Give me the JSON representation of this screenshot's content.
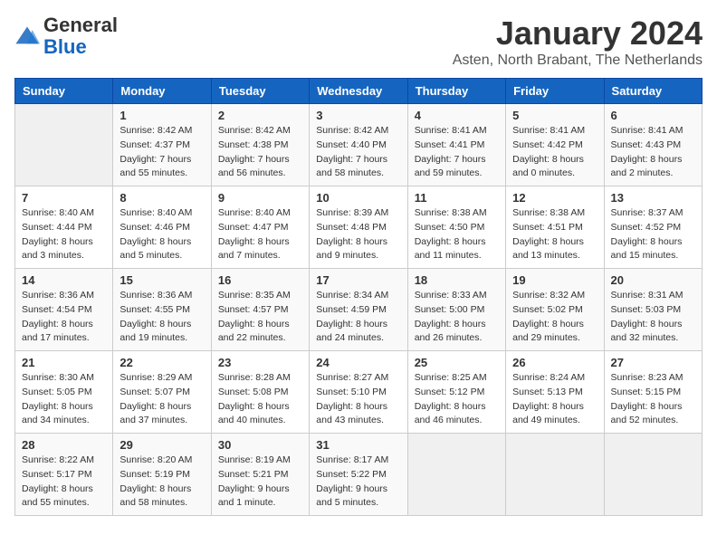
{
  "header": {
    "logo_line1": "General",
    "logo_line2": "Blue",
    "month": "January 2024",
    "location": "Asten, North Brabant, The Netherlands"
  },
  "weekdays": [
    "Sunday",
    "Monday",
    "Tuesday",
    "Wednesday",
    "Thursday",
    "Friday",
    "Saturday"
  ],
  "weeks": [
    [
      {
        "day": "",
        "sunrise": "",
        "sunset": "",
        "daylight": ""
      },
      {
        "day": "1",
        "sunrise": "Sunrise: 8:42 AM",
        "sunset": "Sunset: 4:37 PM",
        "daylight": "Daylight: 7 hours and 55 minutes."
      },
      {
        "day": "2",
        "sunrise": "Sunrise: 8:42 AM",
        "sunset": "Sunset: 4:38 PM",
        "daylight": "Daylight: 7 hours and 56 minutes."
      },
      {
        "day": "3",
        "sunrise": "Sunrise: 8:42 AM",
        "sunset": "Sunset: 4:40 PM",
        "daylight": "Daylight: 7 hours and 58 minutes."
      },
      {
        "day": "4",
        "sunrise": "Sunrise: 8:41 AM",
        "sunset": "Sunset: 4:41 PM",
        "daylight": "Daylight: 7 hours and 59 minutes."
      },
      {
        "day": "5",
        "sunrise": "Sunrise: 8:41 AM",
        "sunset": "Sunset: 4:42 PM",
        "daylight": "Daylight: 8 hours and 0 minutes."
      },
      {
        "day": "6",
        "sunrise": "Sunrise: 8:41 AM",
        "sunset": "Sunset: 4:43 PM",
        "daylight": "Daylight: 8 hours and 2 minutes."
      }
    ],
    [
      {
        "day": "7",
        "sunrise": "Sunrise: 8:40 AM",
        "sunset": "Sunset: 4:44 PM",
        "daylight": "Daylight: 8 hours and 3 minutes."
      },
      {
        "day": "8",
        "sunrise": "Sunrise: 8:40 AM",
        "sunset": "Sunset: 4:46 PM",
        "daylight": "Daylight: 8 hours and 5 minutes."
      },
      {
        "day": "9",
        "sunrise": "Sunrise: 8:40 AM",
        "sunset": "Sunset: 4:47 PM",
        "daylight": "Daylight: 8 hours and 7 minutes."
      },
      {
        "day": "10",
        "sunrise": "Sunrise: 8:39 AM",
        "sunset": "Sunset: 4:48 PM",
        "daylight": "Daylight: 8 hours and 9 minutes."
      },
      {
        "day": "11",
        "sunrise": "Sunrise: 8:38 AM",
        "sunset": "Sunset: 4:50 PM",
        "daylight": "Daylight: 8 hours and 11 minutes."
      },
      {
        "day": "12",
        "sunrise": "Sunrise: 8:38 AM",
        "sunset": "Sunset: 4:51 PM",
        "daylight": "Daylight: 8 hours and 13 minutes."
      },
      {
        "day": "13",
        "sunrise": "Sunrise: 8:37 AM",
        "sunset": "Sunset: 4:52 PM",
        "daylight": "Daylight: 8 hours and 15 minutes."
      }
    ],
    [
      {
        "day": "14",
        "sunrise": "Sunrise: 8:36 AM",
        "sunset": "Sunset: 4:54 PM",
        "daylight": "Daylight: 8 hours and 17 minutes."
      },
      {
        "day": "15",
        "sunrise": "Sunrise: 8:36 AM",
        "sunset": "Sunset: 4:55 PM",
        "daylight": "Daylight: 8 hours and 19 minutes."
      },
      {
        "day": "16",
        "sunrise": "Sunrise: 8:35 AM",
        "sunset": "Sunset: 4:57 PM",
        "daylight": "Daylight: 8 hours and 22 minutes."
      },
      {
        "day": "17",
        "sunrise": "Sunrise: 8:34 AM",
        "sunset": "Sunset: 4:59 PM",
        "daylight": "Daylight: 8 hours and 24 minutes."
      },
      {
        "day": "18",
        "sunrise": "Sunrise: 8:33 AM",
        "sunset": "Sunset: 5:00 PM",
        "daylight": "Daylight: 8 hours and 26 minutes."
      },
      {
        "day": "19",
        "sunrise": "Sunrise: 8:32 AM",
        "sunset": "Sunset: 5:02 PM",
        "daylight": "Daylight: 8 hours and 29 minutes."
      },
      {
        "day": "20",
        "sunrise": "Sunrise: 8:31 AM",
        "sunset": "Sunset: 5:03 PM",
        "daylight": "Daylight: 8 hours and 32 minutes."
      }
    ],
    [
      {
        "day": "21",
        "sunrise": "Sunrise: 8:30 AM",
        "sunset": "Sunset: 5:05 PM",
        "daylight": "Daylight: 8 hours and 34 minutes."
      },
      {
        "day": "22",
        "sunrise": "Sunrise: 8:29 AM",
        "sunset": "Sunset: 5:07 PM",
        "daylight": "Daylight: 8 hours and 37 minutes."
      },
      {
        "day": "23",
        "sunrise": "Sunrise: 8:28 AM",
        "sunset": "Sunset: 5:08 PM",
        "daylight": "Daylight: 8 hours and 40 minutes."
      },
      {
        "day": "24",
        "sunrise": "Sunrise: 8:27 AM",
        "sunset": "Sunset: 5:10 PM",
        "daylight": "Daylight: 8 hours and 43 minutes."
      },
      {
        "day": "25",
        "sunrise": "Sunrise: 8:25 AM",
        "sunset": "Sunset: 5:12 PM",
        "daylight": "Daylight: 8 hours and 46 minutes."
      },
      {
        "day": "26",
        "sunrise": "Sunrise: 8:24 AM",
        "sunset": "Sunset: 5:13 PM",
        "daylight": "Daylight: 8 hours and 49 minutes."
      },
      {
        "day": "27",
        "sunrise": "Sunrise: 8:23 AM",
        "sunset": "Sunset: 5:15 PM",
        "daylight": "Daylight: 8 hours and 52 minutes."
      }
    ],
    [
      {
        "day": "28",
        "sunrise": "Sunrise: 8:22 AM",
        "sunset": "Sunset: 5:17 PM",
        "daylight": "Daylight: 8 hours and 55 minutes."
      },
      {
        "day": "29",
        "sunrise": "Sunrise: 8:20 AM",
        "sunset": "Sunset: 5:19 PM",
        "daylight": "Daylight: 8 hours and 58 minutes."
      },
      {
        "day": "30",
        "sunrise": "Sunrise: 8:19 AM",
        "sunset": "Sunset: 5:21 PM",
        "daylight": "Daylight: 9 hours and 1 minute."
      },
      {
        "day": "31",
        "sunrise": "Sunrise: 8:17 AM",
        "sunset": "Sunset: 5:22 PM",
        "daylight": "Daylight: 9 hours and 5 minutes."
      },
      {
        "day": "",
        "sunrise": "",
        "sunset": "",
        "daylight": ""
      },
      {
        "day": "",
        "sunrise": "",
        "sunset": "",
        "daylight": ""
      },
      {
        "day": "",
        "sunrise": "",
        "sunset": "",
        "daylight": ""
      }
    ]
  ]
}
